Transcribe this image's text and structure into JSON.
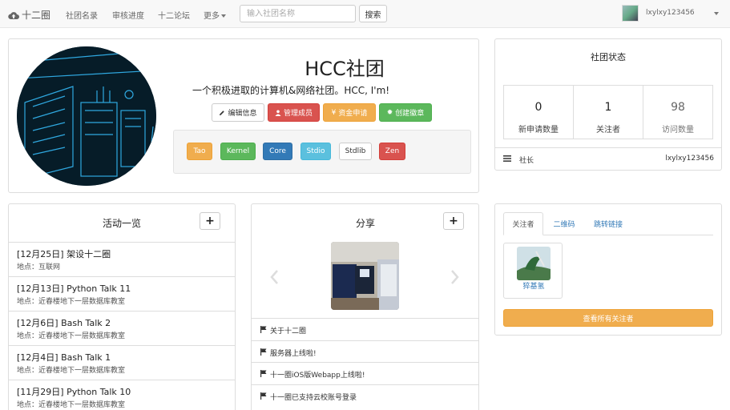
{
  "navbar": {
    "brand": "十二圈",
    "links": [
      "社团名录",
      "审核进度",
      "十二论坛",
      "更多"
    ],
    "search_placeholder": "输入社团名称",
    "search_button": "搜索",
    "username": "lxylxy123456"
  },
  "club": {
    "name": "HCC社团",
    "description": "一个积极进取的计算机&网络社团。HCC, I'm!",
    "actions": [
      "编辑信息",
      "管理成员",
      "资金申请",
      "创建徽章"
    ],
    "tags": [
      "Tao",
      "Kernel",
      "Core",
      "Stdio",
      "Stdlib",
      "Zen"
    ]
  },
  "status": {
    "title": "社团状态",
    "stats": [
      {
        "value": "0",
        "label": "新申请数量"
      },
      {
        "value": "1",
        "label": "关注者"
      },
      {
        "value": "98",
        "label": "访问数量"
      }
    ],
    "leader_label": "社长",
    "leader_name": "lxylxy123456"
  },
  "activities": {
    "title": "活动一览",
    "add_label": "+",
    "items": [
      {
        "title": "[12月25日] 架设十二圈",
        "location": "地点：互联网"
      },
      {
        "title": "[12月13日] Python Talk 11",
        "location": "地点：近春楼地下一层数据库教室"
      },
      {
        "title": "[12月6日] Bash Talk 2",
        "location": "地点：近春楼地下一层数据库教室"
      },
      {
        "title": "[12月4日] Bash Talk 1",
        "location": "地点：近春楼地下一层数据库教室"
      },
      {
        "title": "[11月29日] Python Talk 10",
        "location": "地点：近春楼地下一层数据库教室"
      }
    ]
  },
  "share": {
    "title": "分享",
    "add_label": "+",
    "items": [
      "关于十二圈",
      "服务器上线啦!",
      "十一圈iOS版Webapp上线啦!",
      "十一圈已支持云校账号登录"
    ]
  },
  "followers": {
    "tabs": [
      "关注者",
      "二维码",
      "跳转链接"
    ],
    "follower_name": "猝基氢",
    "view_all": "查看所有关注者"
  },
  "colors": {
    "danger": "#d9534f",
    "warning": "#f0ad4e",
    "success": "#5cb85c",
    "primary": "#337ab7",
    "info": "#5bc0de"
  }
}
